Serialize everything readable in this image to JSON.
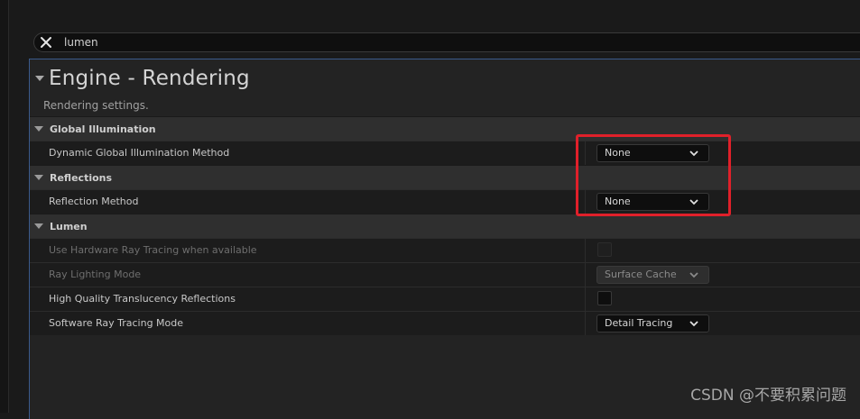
{
  "search": {
    "value": "lumen",
    "clear_icon": "close-icon"
  },
  "section": {
    "title": "Engine - Rendering",
    "subtitle": "Rendering settings."
  },
  "categories": [
    {
      "label": "Global Illumination",
      "properties": [
        {
          "label": "Dynamic Global Illumination Method",
          "type": "combo",
          "value": "None",
          "enabled": true
        }
      ]
    },
    {
      "label": "Reflections",
      "properties": [
        {
          "label": "Reflection Method",
          "type": "combo",
          "value": "None",
          "enabled": true
        }
      ]
    },
    {
      "label": "Lumen",
      "properties": [
        {
          "label": "Use Hardware Ray Tracing when available",
          "type": "checkbox",
          "checked": false,
          "enabled": false
        },
        {
          "label": "Ray Lighting Mode",
          "type": "combo",
          "value": "Surface Cache",
          "enabled": false
        },
        {
          "label": "High Quality Translucency Reflections",
          "type": "checkbox",
          "checked": false,
          "enabled": true
        },
        {
          "label": "Software Ray Tracing Mode",
          "type": "combo",
          "value": "Detail Tracing",
          "enabled": true
        }
      ]
    }
  ],
  "colors": {
    "highlight": "#e0202a",
    "selection_border": "#3a5a8c"
  },
  "watermark": "CSDN @不要积累问题"
}
